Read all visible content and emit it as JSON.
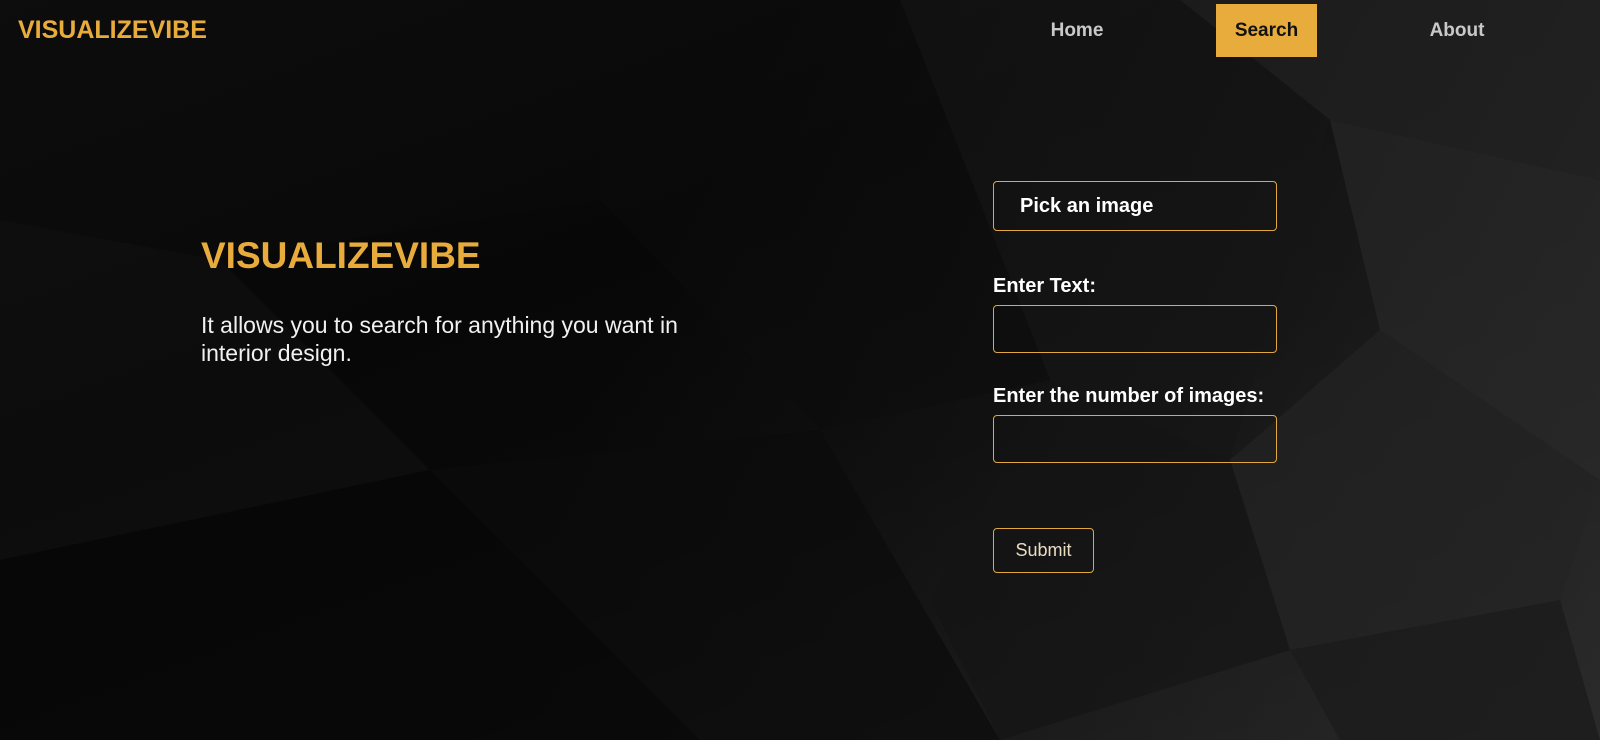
{
  "app": {
    "brand": "VISUALIZEVIBE"
  },
  "nav": {
    "home": "Home",
    "search": "Search",
    "about": "About",
    "active": "Search"
  },
  "hero": {
    "title": "VISUALIZEVIBE",
    "description": "It allows you to search for anything you want in interior design."
  },
  "form": {
    "pick_image_label": "Pick an image",
    "text_label": "Enter Text:",
    "text_value": "",
    "count_label": "Enter the number of images:",
    "count_value": "",
    "submit_label": "Submit"
  },
  "colors": {
    "accent": "#e8ac3c",
    "background": "#050505",
    "text_primary": "#ffffff",
    "nav_text": "#c9c9c9"
  }
}
